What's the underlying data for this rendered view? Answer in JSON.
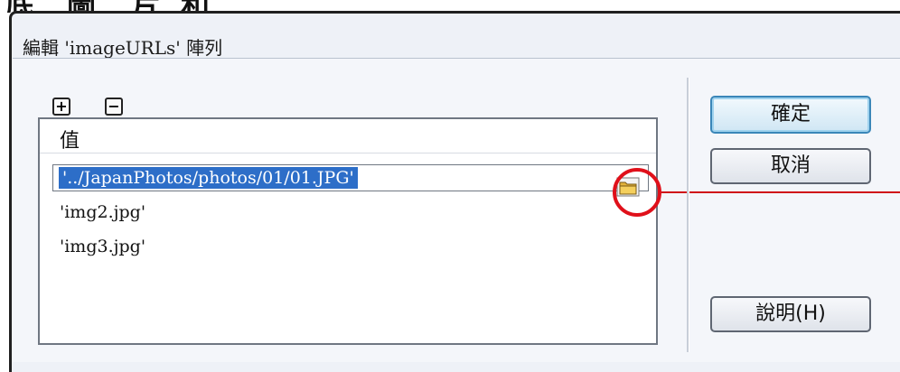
{
  "top_clip": [
    "底",
    "圖",
    "片",
    "和"
  ],
  "dialog": {
    "title": "編輯 'imageURLs' 陣列",
    "add_button": "+",
    "remove_button": "−",
    "list": {
      "column_header": "值",
      "items": [
        "'../JapanPhotos/photos/01/01.JPG'",
        "'img2.jpg'",
        "'img3.jpg'"
      ],
      "selected_index": 0
    },
    "buttons": {
      "ok": "確定",
      "cancel": "取消",
      "help": "說明(H)"
    }
  },
  "colors": {
    "selection": "#2d6ec8",
    "highlight_circle": "#e0101a",
    "primary_button_border": "#3a86b8"
  },
  "icons": [
    "browse-folder-icon"
  ]
}
